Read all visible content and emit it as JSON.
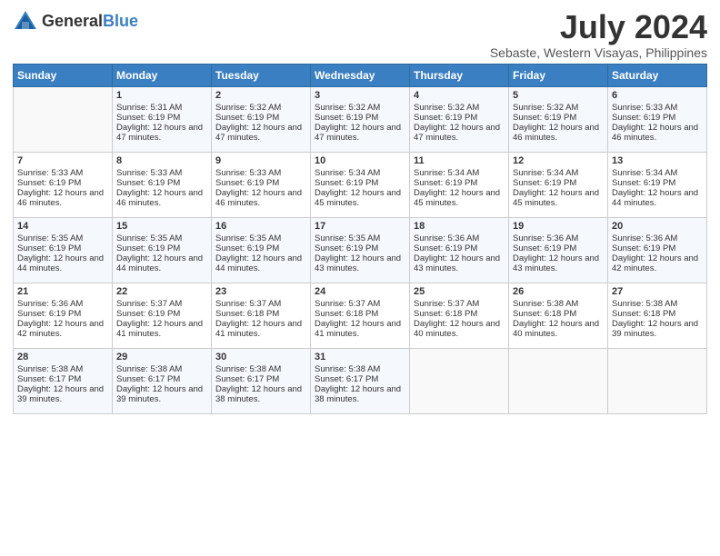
{
  "header": {
    "logo_general": "General",
    "logo_blue": "Blue",
    "month_year": "July 2024",
    "location": "Sebaste, Western Visayas, Philippines"
  },
  "days_of_week": [
    "Sunday",
    "Monday",
    "Tuesday",
    "Wednesday",
    "Thursday",
    "Friday",
    "Saturday"
  ],
  "weeks": [
    [
      {
        "day": "",
        "sunrise": "",
        "sunset": "",
        "daylight": ""
      },
      {
        "day": "1",
        "sunrise": "Sunrise: 5:31 AM",
        "sunset": "Sunset: 6:19 PM",
        "daylight": "Daylight: 12 hours and 47 minutes."
      },
      {
        "day": "2",
        "sunrise": "Sunrise: 5:32 AM",
        "sunset": "Sunset: 6:19 PM",
        "daylight": "Daylight: 12 hours and 47 minutes."
      },
      {
        "day": "3",
        "sunrise": "Sunrise: 5:32 AM",
        "sunset": "Sunset: 6:19 PM",
        "daylight": "Daylight: 12 hours and 47 minutes."
      },
      {
        "day": "4",
        "sunrise": "Sunrise: 5:32 AM",
        "sunset": "Sunset: 6:19 PM",
        "daylight": "Daylight: 12 hours and 47 minutes."
      },
      {
        "day": "5",
        "sunrise": "Sunrise: 5:32 AM",
        "sunset": "Sunset: 6:19 PM",
        "daylight": "Daylight: 12 hours and 46 minutes."
      },
      {
        "day": "6",
        "sunrise": "Sunrise: 5:33 AM",
        "sunset": "Sunset: 6:19 PM",
        "daylight": "Daylight: 12 hours and 46 minutes."
      }
    ],
    [
      {
        "day": "7",
        "sunrise": "Sunrise: 5:33 AM",
        "sunset": "Sunset: 6:19 PM",
        "daylight": "Daylight: 12 hours and 46 minutes."
      },
      {
        "day": "8",
        "sunrise": "Sunrise: 5:33 AM",
        "sunset": "Sunset: 6:19 PM",
        "daylight": "Daylight: 12 hours and 46 minutes."
      },
      {
        "day": "9",
        "sunrise": "Sunrise: 5:33 AM",
        "sunset": "Sunset: 6:19 PM",
        "daylight": "Daylight: 12 hours and 46 minutes."
      },
      {
        "day": "10",
        "sunrise": "Sunrise: 5:34 AM",
        "sunset": "Sunset: 6:19 PM",
        "daylight": "Daylight: 12 hours and 45 minutes."
      },
      {
        "day": "11",
        "sunrise": "Sunrise: 5:34 AM",
        "sunset": "Sunset: 6:19 PM",
        "daylight": "Daylight: 12 hours and 45 minutes."
      },
      {
        "day": "12",
        "sunrise": "Sunrise: 5:34 AM",
        "sunset": "Sunset: 6:19 PM",
        "daylight": "Daylight: 12 hours and 45 minutes."
      },
      {
        "day": "13",
        "sunrise": "Sunrise: 5:34 AM",
        "sunset": "Sunset: 6:19 PM",
        "daylight": "Daylight: 12 hours and 44 minutes."
      }
    ],
    [
      {
        "day": "14",
        "sunrise": "Sunrise: 5:35 AM",
        "sunset": "Sunset: 6:19 PM",
        "daylight": "Daylight: 12 hours and 44 minutes."
      },
      {
        "day": "15",
        "sunrise": "Sunrise: 5:35 AM",
        "sunset": "Sunset: 6:19 PM",
        "daylight": "Daylight: 12 hours and 44 minutes."
      },
      {
        "day": "16",
        "sunrise": "Sunrise: 5:35 AM",
        "sunset": "Sunset: 6:19 PM",
        "daylight": "Daylight: 12 hours and 44 minutes."
      },
      {
        "day": "17",
        "sunrise": "Sunrise: 5:35 AM",
        "sunset": "Sunset: 6:19 PM",
        "daylight": "Daylight: 12 hours and 43 minutes."
      },
      {
        "day": "18",
        "sunrise": "Sunrise: 5:36 AM",
        "sunset": "Sunset: 6:19 PM",
        "daylight": "Daylight: 12 hours and 43 minutes."
      },
      {
        "day": "19",
        "sunrise": "Sunrise: 5:36 AM",
        "sunset": "Sunset: 6:19 PM",
        "daylight": "Daylight: 12 hours and 43 minutes."
      },
      {
        "day": "20",
        "sunrise": "Sunrise: 5:36 AM",
        "sunset": "Sunset: 6:19 PM",
        "daylight": "Daylight: 12 hours and 42 minutes."
      }
    ],
    [
      {
        "day": "21",
        "sunrise": "Sunrise: 5:36 AM",
        "sunset": "Sunset: 6:19 PM",
        "daylight": "Daylight: 12 hours and 42 minutes."
      },
      {
        "day": "22",
        "sunrise": "Sunrise: 5:37 AM",
        "sunset": "Sunset: 6:19 PM",
        "daylight": "Daylight: 12 hours and 41 minutes."
      },
      {
        "day": "23",
        "sunrise": "Sunrise: 5:37 AM",
        "sunset": "Sunset: 6:18 PM",
        "daylight": "Daylight: 12 hours and 41 minutes."
      },
      {
        "day": "24",
        "sunrise": "Sunrise: 5:37 AM",
        "sunset": "Sunset: 6:18 PM",
        "daylight": "Daylight: 12 hours and 41 minutes."
      },
      {
        "day": "25",
        "sunrise": "Sunrise: 5:37 AM",
        "sunset": "Sunset: 6:18 PM",
        "daylight": "Daylight: 12 hours and 40 minutes."
      },
      {
        "day": "26",
        "sunrise": "Sunrise: 5:38 AM",
        "sunset": "Sunset: 6:18 PM",
        "daylight": "Daylight: 12 hours and 40 minutes."
      },
      {
        "day": "27",
        "sunrise": "Sunrise: 5:38 AM",
        "sunset": "Sunset: 6:18 PM",
        "daylight": "Daylight: 12 hours and 39 minutes."
      }
    ],
    [
      {
        "day": "28",
        "sunrise": "Sunrise: 5:38 AM",
        "sunset": "Sunset: 6:17 PM",
        "daylight": "Daylight: 12 hours and 39 minutes."
      },
      {
        "day": "29",
        "sunrise": "Sunrise: 5:38 AM",
        "sunset": "Sunset: 6:17 PM",
        "daylight": "Daylight: 12 hours and 39 minutes."
      },
      {
        "day": "30",
        "sunrise": "Sunrise: 5:38 AM",
        "sunset": "Sunset: 6:17 PM",
        "daylight": "Daylight: 12 hours and 38 minutes."
      },
      {
        "day": "31",
        "sunrise": "Sunrise: 5:38 AM",
        "sunset": "Sunset: 6:17 PM",
        "daylight": "Daylight: 12 hours and 38 minutes."
      },
      {
        "day": "",
        "sunrise": "",
        "sunset": "",
        "daylight": ""
      },
      {
        "day": "",
        "sunrise": "",
        "sunset": "",
        "daylight": ""
      },
      {
        "day": "",
        "sunrise": "",
        "sunset": "",
        "daylight": ""
      }
    ]
  ]
}
